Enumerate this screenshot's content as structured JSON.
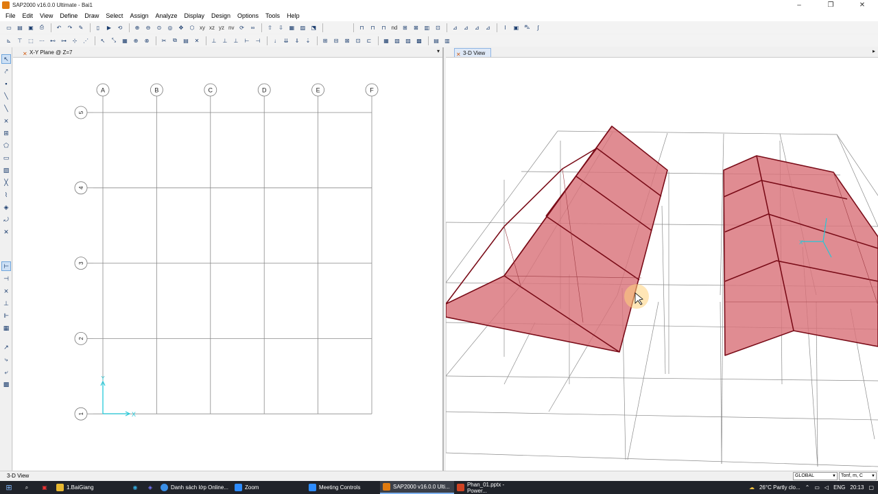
{
  "window": {
    "title": "SAP2000 v16.0.0 Ultimate  - Bai1",
    "controls": [
      "–",
      "❐",
      "✕"
    ]
  },
  "menu": [
    "File",
    "Edit",
    "View",
    "Define",
    "Draw",
    "Select",
    "Assign",
    "Analyze",
    "Display",
    "Design",
    "Options",
    "Tools",
    "Help"
  ],
  "toolbar1": {
    "xy": "xy",
    "xz": "xz",
    "yz": "yz",
    "nv": "nv",
    "nd": "nd"
  },
  "left_view": {
    "tab_label": "X-Y Plane @ Z=7",
    "grid_cols": [
      "A",
      "B",
      "C",
      "D",
      "E",
      "F"
    ],
    "grid_rows": [
      "5",
      "4",
      "3",
      "2",
      "1"
    ],
    "axis_x": "X",
    "axis_y": "Y"
  },
  "right_view": {
    "tab_label": "3-D View"
  },
  "status": {
    "text": "3-D View",
    "coord_system": "GLOBAL",
    "units": "Tonf, m, C"
  },
  "taskbar": {
    "apps": [
      {
        "label": "1.BaiGiang",
        "color": "#e8b830"
      },
      {
        "label": "Danh sách lớp Online...",
        "color": "#3a8ee6"
      },
      {
        "label": "Zoom",
        "color": "#2d8cff"
      },
      {
        "label": "Meeting Controls",
        "color": "#2d8cff"
      },
      {
        "label": "SAP2000 v16.0.0 Ulti...",
        "color": "#e07b10"
      },
      {
        "label": "Phan_01.pptx - Power...",
        "color": "#d04423"
      }
    ],
    "weather": "26°C  Partly clo...",
    "lang": "ENG",
    "time": "20:13"
  },
  "colors": {
    "roof_fill": "#d9737a",
    "roof_edge": "#7a0c18",
    "grid": "#888888",
    "axis": "#22c8d8"
  }
}
